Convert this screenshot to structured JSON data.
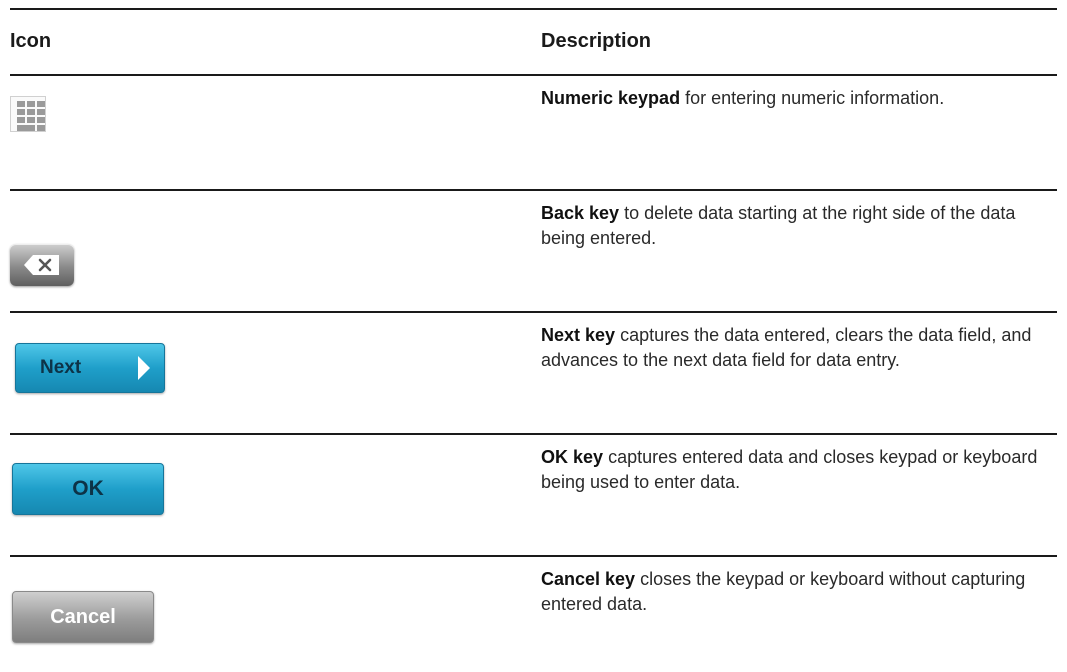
{
  "header": {
    "icon_col": "Icon",
    "desc_col": "Description"
  },
  "rows": [
    {
      "icon": "numeric-keypad-icon",
      "term": "Numeric keypad",
      "text": "for entering numeric information."
    },
    {
      "icon": "backspace-icon",
      "term": "Back key",
      "text": "to delete data starting at the right side of the data being entered."
    },
    {
      "icon": "next-button",
      "button_label": "Next",
      "term": "Next key",
      "text": "captures the data entered, clears the data field, and advances to the next data field for data entry."
    },
    {
      "icon": "ok-button",
      "button_label": "OK",
      "term": "OK key",
      "text": "captures entered data and closes keypad or keyboard being used to enter data."
    },
    {
      "icon": "cancel-button",
      "button_label": "Cancel",
      "term": "Cancel key",
      "text": "closes the keypad or keyboard without capturing entered data."
    }
  ],
  "colors": {
    "accent_blue": "#1f9fca",
    "neutral_gray": "#8a8a8a"
  }
}
